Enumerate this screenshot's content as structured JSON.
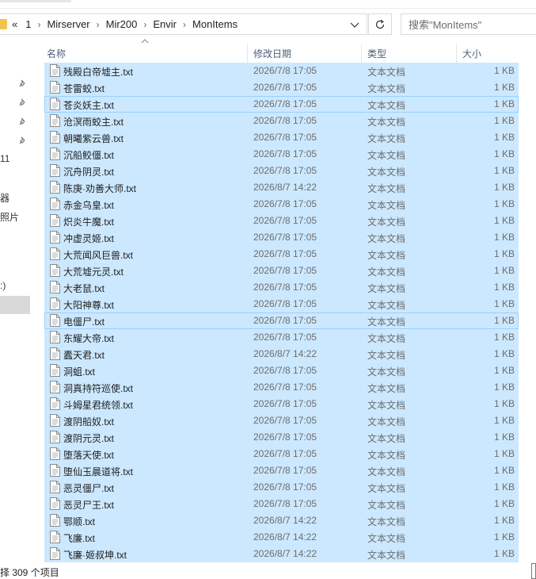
{
  "address": {
    "overflow_label": "«",
    "crumbs": [
      "1",
      "Mirserver",
      "Mir200",
      "Envir",
      "MonItems"
    ]
  },
  "search": {
    "placeholder": "搜索\"MonItems\""
  },
  "nav": {
    "partial_labels": [
      "11",
      "器",
      "照片",
      ":)"
    ]
  },
  "columns": {
    "name": "名称",
    "date": "修改日期",
    "type": "类型",
    "size": "大小"
  },
  "files": [
    {
      "name": "残殿白帝墟主.txt",
      "date": "2026/7/8 17:05",
      "type": "文本文档",
      "size": "1 KB"
    },
    {
      "name": "苍雷蛟.txt",
      "date": "2026/7/8 17:05",
      "type": "文本文档",
      "size": "1 KB"
    },
    {
      "name": "苍炎妖主.txt",
      "date": "2026/7/8 17:05",
      "type": "文本文档",
      "size": "1 KB"
    },
    {
      "name": "沧溟雨蛟主.txt",
      "date": "2026/7/8 17:05",
      "type": "文本文档",
      "size": "1 KB"
    },
    {
      "name": "朝曦紫云兽.txt",
      "date": "2026/7/8 17:05",
      "type": "文本文档",
      "size": "1 KB"
    },
    {
      "name": "沉船鲛僵.txt",
      "date": "2026/7/8 17:05",
      "type": "文本文档",
      "size": "1 KB"
    },
    {
      "name": "沉舟阴灵.txt",
      "date": "2026/7/8 17:05",
      "type": "文本文档",
      "size": "1 KB"
    },
    {
      "name": "陈庚·劝善大师.txt",
      "date": "2026/8/7 14:22",
      "type": "文本文档",
      "size": "1 KB"
    },
    {
      "name": "赤金乌皇.txt",
      "date": "2026/7/8 17:05",
      "type": "文本文档",
      "size": "1 KB"
    },
    {
      "name": "炽炎牛魔.txt",
      "date": "2026/7/8 17:05",
      "type": "文本文档",
      "size": "1 KB"
    },
    {
      "name": "冲虚灵姬.txt",
      "date": "2026/7/8 17:05",
      "type": "文本文档",
      "size": "1 KB"
    },
    {
      "name": "大荒闻风巨兽.txt",
      "date": "2026/7/8 17:05",
      "type": "文本文档",
      "size": "1 KB"
    },
    {
      "name": "大荒墟元灵.txt",
      "date": "2026/7/8 17:05",
      "type": "文本文档",
      "size": "1 KB"
    },
    {
      "name": "大老鼠.txt",
      "date": "2026/7/8 17:05",
      "type": "文本文档",
      "size": "1 KB"
    },
    {
      "name": "大阳神尊.txt",
      "date": "2026/7/8 17:05",
      "type": "文本文档",
      "size": "1 KB"
    },
    {
      "name": "电僵尸.txt",
      "date": "2026/7/8 17:05",
      "type": "文本文档",
      "size": "1 KB"
    },
    {
      "name": "东耀大帝.txt",
      "date": "2026/7/8 17:05",
      "type": "文本文档",
      "size": "1 KB"
    },
    {
      "name": "蠹天君.txt",
      "date": "2026/8/7 14:22",
      "type": "文本文档",
      "size": "1 KB"
    },
    {
      "name": "洞蛆.txt",
      "date": "2026/7/8 17:05",
      "type": "文本文档",
      "size": "1 KB"
    },
    {
      "name": "洞真持符巡使.txt",
      "date": "2026/7/8 17:05",
      "type": "文本文档",
      "size": "1 KB"
    },
    {
      "name": "斗姆星君统领.txt",
      "date": "2026/7/8 17:05",
      "type": "文本文档",
      "size": "1 KB"
    },
    {
      "name": "渡阴船奴.txt",
      "date": "2026/7/8 17:05",
      "type": "文本文档",
      "size": "1 KB"
    },
    {
      "name": "渡阴元灵.txt",
      "date": "2026/7/8 17:05",
      "type": "文本文档",
      "size": "1 KB"
    },
    {
      "name": "堕落天使.txt",
      "date": "2026/7/8 17:05",
      "type": "文本文档",
      "size": "1 KB"
    },
    {
      "name": "堕仙玉晨道将.txt",
      "date": "2026/7/8 17:05",
      "type": "文本文档",
      "size": "1 KB"
    },
    {
      "name": "恶灵僵尸.txt",
      "date": "2026/7/8 17:05",
      "type": "文本文档",
      "size": "1 KB"
    },
    {
      "name": "恶灵尸王.txt",
      "date": "2026/7/8 17:05",
      "type": "文本文档",
      "size": "1 KB"
    },
    {
      "name": "鄂顺.txt",
      "date": "2026/8/7 14:22",
      "type": "文本文档",
      "size": "1 KB"
    },
    {
      "name": "飞廉.txt",
      "date": "2026/8/7 14:22",
      "type": "文本文档",
      "size": "1 KB"
    },
    {
      "name": "飞廉·姬叔坤.txt",
      "date": "2026/8/7 14:22",
      "type": "文本文档",
      "size": "1 KB"
    }
  ],
  "status": {
    "text": "择 309 个项目"
  },
  "colors": {
    "selection": "#cce8ff",
    "selection_border": "#99d1ff",
    "header_text": "#4c607a",
    "folder": "#f2c34f"
  },
  "icons": {
    "file": "text-file-icon",
    "refresh": "refresh-icon",
    "dropdown": "chevron-down-icon",
    "pin": "pin-icon",
    "sort": "sort-ascending-icon"
  }
}
